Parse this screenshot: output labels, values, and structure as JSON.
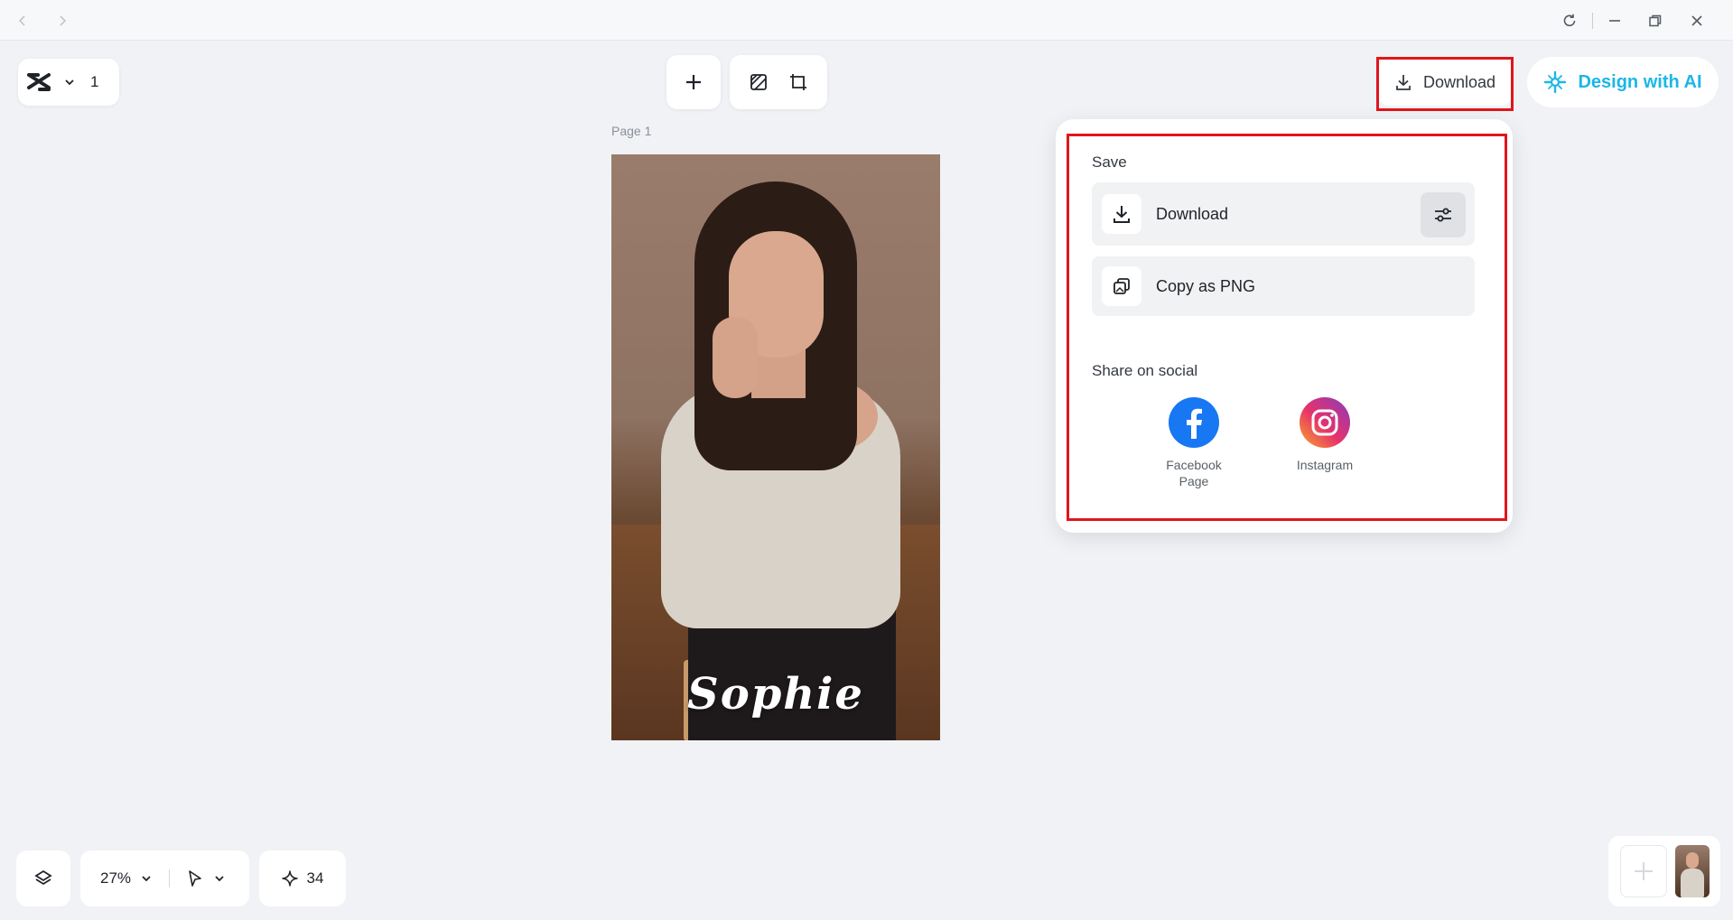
{
  "toolbar": {
    "page_count": "1",
    "download_label": "Download",
    "design_ai_label": "Design with AI"
  },
  "canvas": {
    "page_label": "Page 1",
    "artwork_text": "Sophie"
  },
  "download_panel": {
    "save_title": "Save",
    "download_label": "Download",
    "copy_png_label": "Copy as PNG",
    "share_title": "Share on social",
    "social": [
      {
        "label_line1": "Facebook",
        "label_line2": "Page",
        "icon": "facebook-icon"
      },
      {
        "label_line1": "Instagram",
        "label_line2": "",
        "icon": "instagram-icon"
      }
    ]
  },
  "bottom_bar": {
    "zoom": "27%",
    "credits": "34"
  },
  "colors": {
    "accent": "#1bb6e8",
    "highlight_box": "#e0161b",
    "facebook": "#1877f2"
  }
}
